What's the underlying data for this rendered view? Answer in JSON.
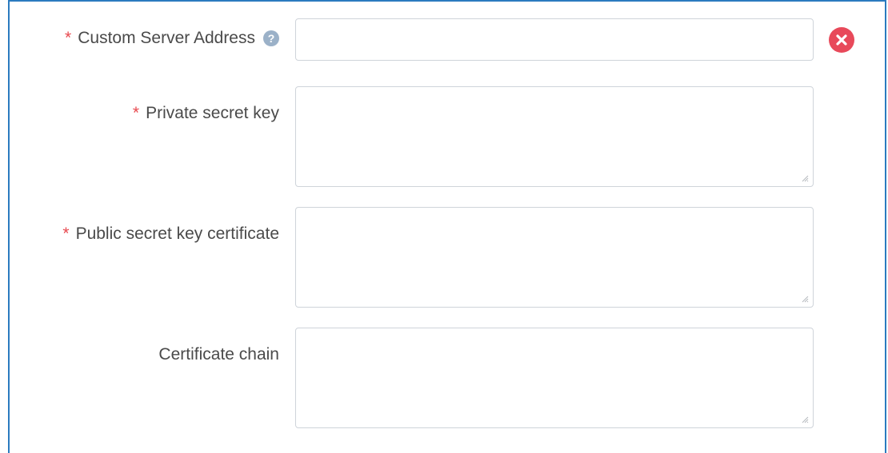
{
  "form": {
    "required_marker": "*",
    "custom_server_address": {
      "label": "Custom Server Address",
      "value": "",
      "help_icon": "question-circle-icon",
      "clear_icon": "close-circle-icon"
    },
    "private_secret_key": {
      "label": "Private secret key",
      "value": ""
    },
    "public_secret_key_certificate": {
      "label": "Public secret key certificate",
      "value": ""
    },
    "certificate_chain": {
      "label": "Certificate chain",
      "value": ""
    }
  },
  "colors": {
    "accent_border": "#2b7bbf",
    "required": "#e8494f",
    "clear_button": "#e8495a",
    "help_icon": "#9bb1c8"
  }
}
